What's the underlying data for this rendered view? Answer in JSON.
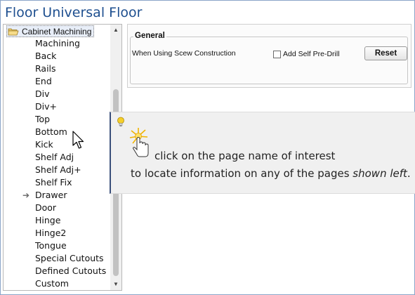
{
  "window": {
    "title": "Floor Universal Floor"
  },
  "tree": {
    "root_label": "Cabinet Machining",
    "root_icon": "folder-open-icon",
    "items": [
      {
        "label": "Machining"
      },
      {
        "label": "Back"
      },
      {
        "label": "Rails"
      },
      {
        "label": "End"
      },
      {
        "label": "Div"
      },
      {
        "label": "Div+"
      },
      {
        "label": "Top"
      },
      {
        "label": "Bottom"
      },
      {
        "label": "Kick"
      },
      {
        "label": "Shelf Adj"
      },
      {
        "label": "Shelf Adj+"
      },
      {
        "label": "Shelf Fix"
      },
      {
        "label": "Drawer",
        "marker": "➔"
      },
      {
        "label": "Door"
      },
      {
        "label": "Hinge"
      },
      {
        "label": "Hinge2"
      },
      {
        "label": "Tongue"
      },
      {
        "label": "Special Cutouts"
      },
      {
        "label": "Defined Cutouts"
      },
      {
        "label": "Custom"
      }
    ]
  },
  "general": {
    "legend": "General",
    "screw_label": "When Using Scew Construction",
    "checkbox_label": "Add Self Pre-Drill",
    "checkbox_checked": false,
    "reset_label": "Reset"
  },
  "tip": {
    "line1": "click on the page name of interest",
    "line2_prefix": "to locate information on any of the pages ",
    "line2_emphasis": "shown left",
    "line2_suffix": "."
  },
  "colors": {
    "title": "#1e4f8f",
    "tip_accent": "#3a4f7a",
    "bulb": "#f0c020"
  }
}
